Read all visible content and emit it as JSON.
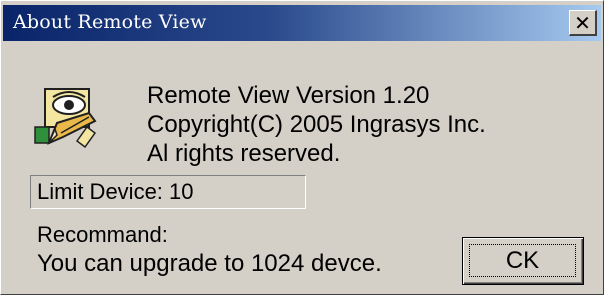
{
  "window": {
    "title": "About Remote View",
    "close_glyph": "✕"
  },
  "icon": {
    "name": "app-eye-pencil-icon",
    "colors": {
      "eye_bg": "#f2e6a0",
      "pencil": "#e8b84a",
      "green": "#2f8f3a",
      "outline": "#202020"
    }
  },
  "info": {
    "version_line": "Remote View Version 1.20",
    "copyright_line": "Copyright(C) 2005 Ingrasys Inc.",
    "rights_line": "Al rights reserved."
  },
  "limit": {
    "text": "Limit Device: 10"
  },
  "recommend": {
    "heading": "Recommand:",
    "message": "You can upgrade to 1024 devce."
  },
  "buttons": {
    "ok_label": "CK"
  },
  "colors": {
    "titlebar_start": "#0a246a",
    "titlebar_end": "#a6caf0",
    "face": "#d4d0c8"
  }
}
